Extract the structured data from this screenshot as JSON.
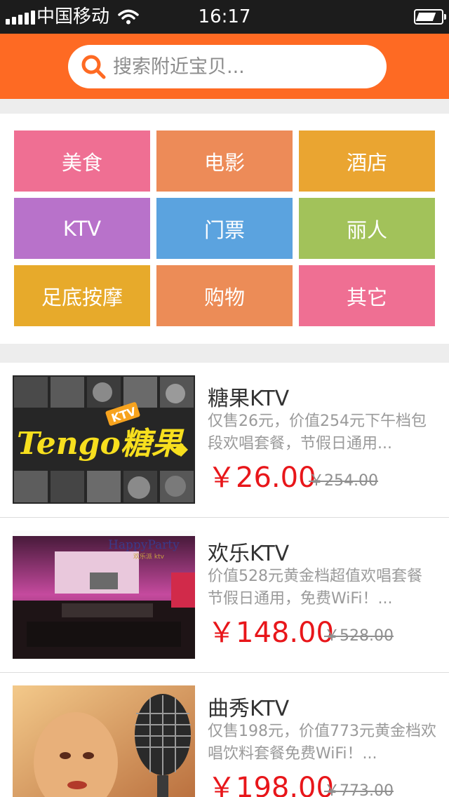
{
  "status_bar": {
    "carrier": "中国移动",
    "time": "16:17"
  },
  "search": {
    "placeholder": "搜索附近宝贝..."
  },
  "categories": [
    {
      "label": "美食",
      "color": "#ef6f93"
    },
    {
      "label": "电影",
      "color": "#ed8b58"
    },
    {
      "label": "酒店",
      "color": "#eaa531"
    },
    {
      "label": "KTV",
      "color": "#b872ca"
    },
    {
      "label": "门票",
      "color": "#5ba3df"
    },
    {
      "label": "丽人",
      "color": "#a2c25a"
    },
    {
      "label": "足底按摩",
      "color": "#e7aa2b"
    },
    {
      "label": "购物",
      "color": "#ec8c57"
    },
    {
      "label": "其它",
      "color": "#ef6f93"
    }
  ],
  "deals": [
    {
      "title": "糖果KTV",
      "desc": "仅售26元，价值254元下午档包段欢唱套餐，节假日通用...",
      "price": "￥26.00",
      "old_price": "￥254.00",
      "image_text": "Tengo糖果",
      "image_badge": "KTV"
    },
    {
      "title": "欢乐KTV",
      "desc": "价值528元黄金档超值欢唱套餐节假日通用，免费WiFi！...",
      "price": "￥148.00",
      "old_price": "￥528.00",
      "image_text": "HappyParty",
      "image_badge": "欢乐派 ktv"
    },
    {
      "title": "曲秀KTV",
      "desc": "仅售198元，价值773元黄金档欢唱饮料套餐免费WiFi！...",
      "price": "￥198.00",
      "old_price": "￥773.00"
    }
  ],
  "colors": {
    "header": "#fe6a23",
    "price": "#e8161a",
    "search_icon": "#fe6a23"
  }
}
